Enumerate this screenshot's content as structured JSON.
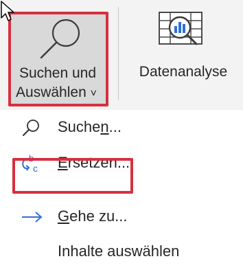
{
  "ribbon": {
    "search_select": {
      "line1": "Suchen und",
      "line2": "Auswählen",
      "chevron": "˅",
      "icon": "magnifier-icon"
    },
    "data_analysis": {
      "label": "Datenanalyse",
      "icon": "data-analysis-icon"
    }
  },
  "menu": {
    "items": [
      {
        "label_pre": "Suche",
        "label_accel": "n",
        "label_post": "...",
        "icon": "search-icon"
      },
      {
        "label_pre": "",
        "label_accel": "E",
        "label_post": "rsetzen...",
        "icon": "replace-icon"
      },
      {
        "label_pre": "",
        "label_accel": "G",
        "label_post": "ehe zu...",
        "icon": "arrow-right-icon"
      },
      {
        "label_pre": "Inhalte auswählen",
        "label_accel": "",
        "label_post": "",
        "icon": ""
      }
    ]
  },
  "colors": {
    "highlight": "#d6303f",
    "accent": "#2f6fd6",
    "ribbon_bg": "#f3f3f3",
    "pressed_bg": "#d9d9d9"
  }
}
